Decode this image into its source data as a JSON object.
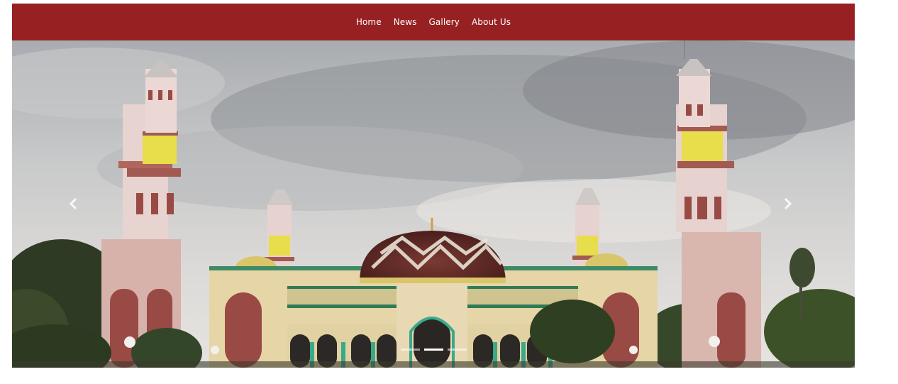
{
  "colors": {
    "navbar_bg": "#962022",
    "nav_text": "#ffffff",
    "indicator_active": "#ffffff",
    "indicator_inactive": "rgba(255,255,255,0.55)"
  },
  "nav": {
    "items": [
      {
        "label": "Home"
      },
      {
        "label": "News"
      },
      {
        "label": "Gallery"
      },
      {
        "label": "About Us"
      }
    ]
  },
  "carousel": {
    "slide_count": 3,
    "active_index": 1,
    "prev_icon": "chevron-left-icon",
    "next_icon": "chevron-right-icon"
  }
}
